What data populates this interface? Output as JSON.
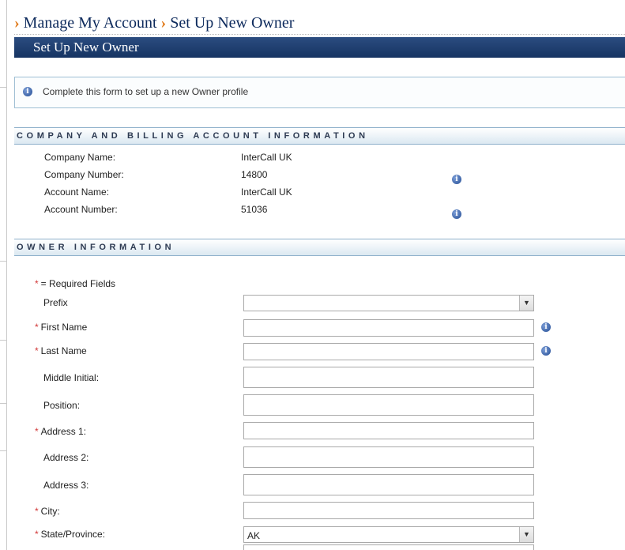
{
  "breadcrumb": {
    "parent": "Manage My Account",
    "current": "Set Up New Owner",
    "separator": "›"
  },
  "title_bar": {
    "title": "Set Up New Owner"
  },
  "info": {
    "icon": "info-icon",
    "text": "Complete this form to set up a new Owner profile"
  },
  "company_section": {
    "title": "COMPANY AND BILLING ACCOUNT INFORMATION",
    "rows": [
      {
        "label": "Company Name:",
        "value": "InterCall UK"
      },
      {
        "label": "Company Number:",
        "value": "14800"
      },
      {
        "label": "Account Name:",
        "value": "InterCall UK"
      },
      {
        "label": "Account Number:",
        "value": "51036"
      }
    ]
  },
  "owner_section": {
    "title": "OWNER INFORMATION",
    "required_marker": "*",
    "required_note": "= Required Fields",
    "fields": [
      {
        "label": "Prefix",
        "required": false,
        "type": "select",
        "value": ""
      },
      {
        "label": "First Name",
        "required": true,
        "type": "text",
        "value": ""
      },
      {
        "label": "Last Name",
        "required": true,
        "type": "text",
        "value": ""
      },
      {
        "label": "Middle Initial:",
        "required": false,
        "type": "text",
        "value": ""
      },
      {
        "label": "Position:",
        "required": false,
        "type": "text",
        "value": ""
      },
      {
        "label": "Address 1:",
        "required": true,
        "type": "text",
        "value": ""
      },
      {
        "label": "Address 2:",
        "required": false,
        "type": "text",
        "value": ""
      },
      {
        "label": "Address 3:",
        "required": false,
        "type": "text",
        "value": ""
      },
      {
        "label": "City:",
        "required": true,
        "type": "text",
        "value": ""
      },
      {
        "label": "State/Province:",
        "required": true,
        "type": "select",
        "value": "AK"
      }
    ]
  },
  "colors": {
    "title_bar": "#1e3d6e",
    "breadcrumb_arrow": "#e07a1a",
    "required": "#d23a3a",
    "section_border": "#8fb1cb"
  }
}
